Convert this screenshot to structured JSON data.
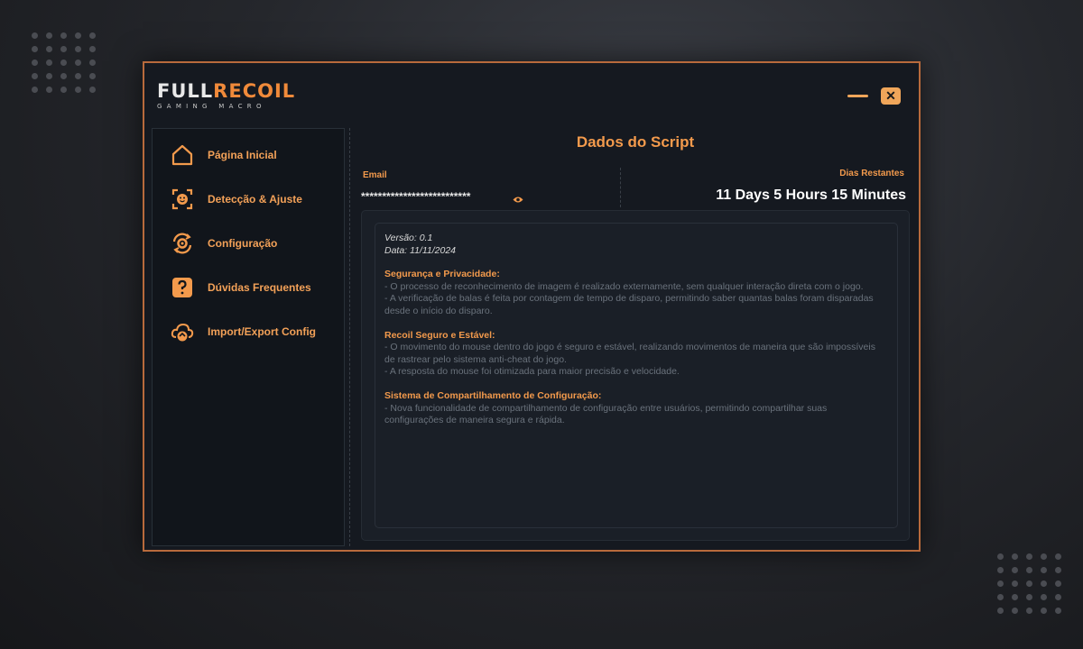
{
  "brand": {
    "logo_full": "FULL",
    "logo_recoil": "RECOIL",
    "logo_sub": "GAMING MACRO",
    "accent": "#f39a4c",
    "border": "#b86a3c"
  },
  "window_controls": {
    "minimize_icon": "minimize-icon",
    "close_icon": "close-icon",
    "close_glyph": "✕"
  },
  "sidebar": {
    "items": [
      {
        "label": "Página Inicial",
        "icon": "home-icon"
      },
      {
        "label": "Detecção & Ajuste",
        "icon": "face-scan-icon"
      },
      {
        "label": "Configuração",
        "icon": "gear-refresh-icon"
      },
      {
        "label": "Dúvidas Frequentes",
        "icon": "question-icon"
      },
      {
        "label": "Import/Export Config",
        "icon": "cloud-sync-icon"
      }
    ]
  },
  "main": {
    "title": "Dados do Script",
    "email_label": "Email",
    "email_value": "**************************",
    "eye_icon": "eye-icon",
    "days_label": "Dias Restantes",
    "days_value": "11 Days 5 Hours 15 Minutes"
  },
  "info": {
    "version": "Versão: 0.1",
    "date": "Data: 11/11/2024",
    "sections": [
      {
        "title": "Segurança e Privacidade:",
        "lines": [
          "- O processo de reconhecimento de imagem é realizado externamente, sem qualquer interação direta com o jogo.",
          "- A verificação de balas é feita por contagem de tempo de disparo, permitindo saber quantas balas foram disparadas desde o início do disparo."
        ]
      },
      {
        "title": "Recoil Seguro e Estável:",
        "lines": [
          "- O movimento do mouse dentro do jogo é seguro e estável, realizando movimentos de maneira que são impossíveis de rastrear pelo sistema anti-cheat do jogo.",
          "- A resposta do mouse foi otimizada para maior precisão e velocidade."
        ]
      },
      {
        "title": "Sistema de Compartilhamento de Configuração:",
        "lines": [
          "- Nova funcionalidade de compartilhamento de configuração entre usuários, permitindo compartilhar suas configurações de maneira segura e rápida."
        ]
      }
    ]
  }
}
